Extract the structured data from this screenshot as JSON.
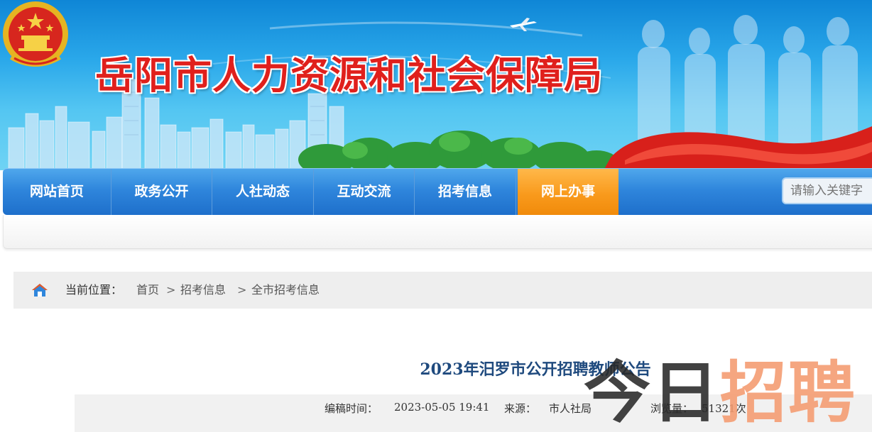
{
  "header": {
    "site_title": "岳阳市人力资源和社会保障局",
    "colors": {
      "title_red": "#e0201c",
      "sky_blue": "#2aa8ea",
      "nav_blue": "#2f86dc",
      "nav_active_orange": "#f99a1c"
    }
  },
  "nav": {
    "items": [
      {
        "label": "网站首页",
        "active": false
      },
      {
        "label": "政务公开",
        "active": false
      },
      {
        "label": "人社动态",
        "active": false
      },
      {
        "label": "互动交流",
        "active": false
      },
      {
        "label": "招考信息",
        "active": false
      },
      {
        "label": "网上办事",
        "active": true
      }
    ],
    "search_placeholder": "请输入关键字"
  },
  "breadcrumb": {
    "prefix": "当前位置：",
    "items": [
      "首页",
      "招考信息",
      "全市招考信息"
    ],
    "separator": ">"
  },
  "article": {
    "title": "2023年汨罗市公开招聘教师公告",
    "meta": {
      "date_label": "编稿时间：",
      "date_value": "2023-05-05 19:41",
      "source_label": "来源：",
      "source_value": "市人社局",
      "views_label": "浏览量：",
      "views_value": "51321次"
    }
  },
  "watermark": {
    "part1": "今日",
    "part2": "招聘"
  }
}
